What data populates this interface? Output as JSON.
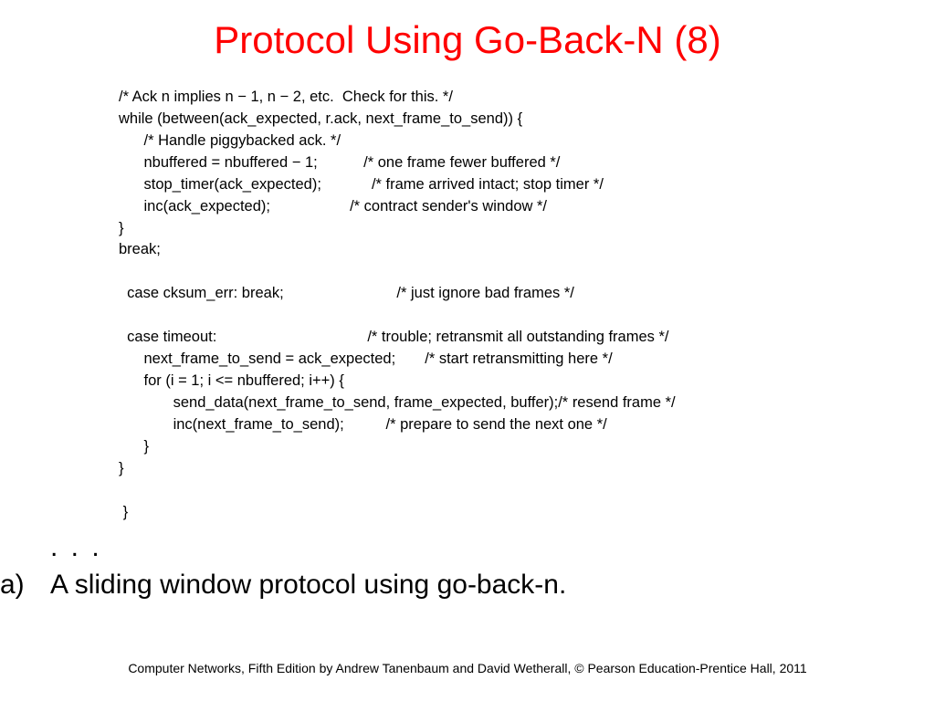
{
  "title": "Protocol Using Go-Back-N (8)",
  "code": {
    "l1": "/* Ack n implies n − 1, n − 2, etc.  Check for this. */",
    "l2": "while (between(ack_expected, r.ack, next_frame_to_send)) {",
    "l3": "      /* Handle piggybacked ack. */",
    "l4": "      nbuffered = nbuffered − 1;           /* one frame fewer buffered */",
    "l5": "      stop_timer(ack_expected);            /* frame arrived intact; stop timer */",
    "l6": "      inc(ack_expected);                   /* contract sender's window */",
    "l7": "}",
    "l8": "break;",
    "l9": "",
    "l10": "case cksum_err: break;                           /* just ignore bad frames */",
    "l11": "",
    "l12": "case timeout:                                    /* trouble; retransmit all outstanding frames */",
    "l13": "      next_frame_to_send = ack_expected;       /* start retransmitting here */",
    "l14": "      for (i = 1; i <= nbuffered; i++) {",
    "l15": "             send_data(next_frame_to_send, frame_expected, buffer);/* resend frame */",
    "l16": "             inc(next_frame_to_send);          /* prepare to send the next one */",
    "l17": "      }",
    "l18": "}",
    "l19": "",
    "l20": "}"
  },
  "ellipsis": ". . .",
  "caption": {
    "label": "a)",
    "body": "A sliding window protocol using go-back-n."
  },
  "footer": "Computer Networks, Fifth Edition by Andrew Tanenbaum and David Wetherall, © Pearson Education-Prentice Hall, 2011"
}
